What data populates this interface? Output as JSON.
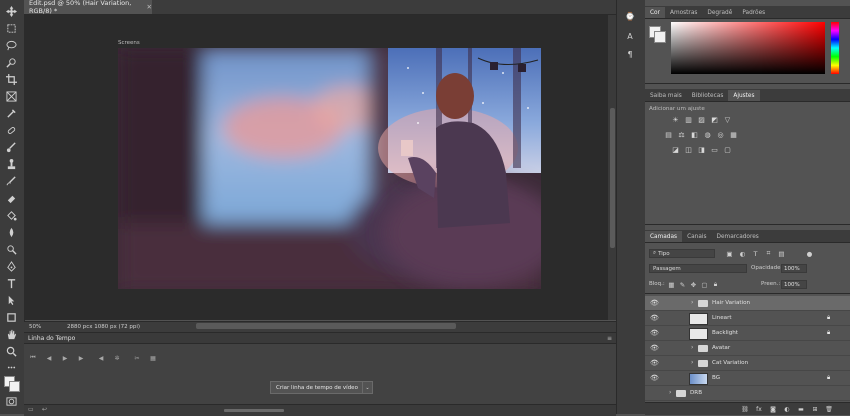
{
  "document": {
    "tab_title": "Edit.psd @ 50% (Hair Variation, RGB/8) *",
    "artboard_label": "Screens",
    "zoom": "50%",
    "doc_info": "2880 pcx 1080 px (72 ppi)"
  },
  "timeline": {
    "panel_title": "Linha do Tempo",
    "create_button": "Criar linha de tempo de vídeo"
  },
  "color_panel": {
    "tabs": [
      "Cor",
      "Amostras",
      "Degradê",
      "Padrões"
    ],
    "active_tab": "Cor",
    "foreground_color": "#f2f2f2",
    "background_color": "#f2f2f2"
  },
  "adjustments_panel": {
    "tabs": [
      "Saiba mais",
      "Bibliotecas",
      "Ajustes"
    ],
    "active_tab": "Ajustes",
    "add_label": "Adicionar um ajuste"
  },
  "layers_panel": {
    "tabs": [
      "Camadas",
      "Canais",
      "Demarcadores"
    ],
    "active_tab": "Camadas",
    "filter_kind": "Tipo",
    "blend_mode": "Passagem",
    "opacity_label": "Opacidade:",
    "opacity_value": "100%",
    "lock_label": "Bloq.:",
    "fill_label": "Preen.:",
    "fill_value": "100%",
    "layers": [
      {
        "name": "Hair Variation",
        "kind": "group",
        "selected": true,
        "locked": false
      },
      {
        "name": "Lineart",
        "kind": "layer",
        "selected": false,
        "locked": true
      },
      {
        "name": "Backlight",
        "kind": "layer",
        "selected": false,
        "locked": true
      },
      {
        "name": "Avatar",
        "kind": "group",
        "selected": false,
        "locked": false
      },
      {
        "name": "Cat Variation",
        "kind": "group",
        "selected": false,
        "locked": false
      },
      {
        "name": "BG",
        "kind": "layer",
        "selected": false,
        "locked": true
      },
      {
        "name": "DRB",
        "kind": "group",
        "selected": false,
        "locked": false
      }
    ]
  },
  "accent_colors": {
    "ui_dark": "#3c3c3c",
    "ui_mid": "#535353",
    "canvas_bg": "#2b2b2b"
  }
}
